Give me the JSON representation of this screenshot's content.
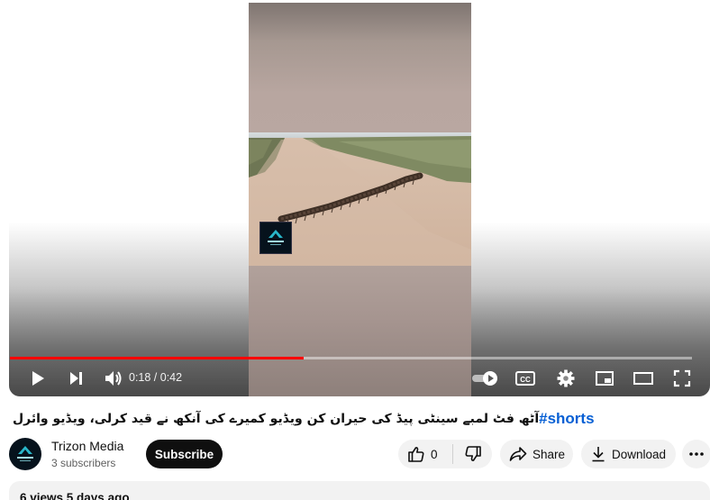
{
  "player": {
    "time_current": "0:18",
    "time_total": "0:42",
    "time_display": "0:18 / 0:42",
    "progress_fraction": 0.43,
    "controls": [
      "play-icon",
      "next-icon",
      "volume-icon",
      "autoplay-toggle",
      "captions-icon",
      "settings-icon",
      "miniplayer-icon",
      "theater-icon",
      "fullscreen-icon"
    ],
    "captions_label": "CC",
    "accent_color": "#ff0000"
  },
  "video": {
    "hashtag": "#shorts",
    "title_text": "آٹھ فٹ لمبے سینٹی پیڈ کی حیران کن ویڈیو کمیرے کی آنکھ نے قید کرلی، ویڈیو وائرل"
  },
  "channel": {
    "name": "Trizon Media",
    "subscribers": "3 subscribers",
    "avatar_icon": "trizon-logo"
  },
  "actions": {
    "subscribe_label": "Subscribe",
    "like_count": "0",
    "share_label": "Share",
    "download_label": "Download"
  },
  "description": {
    "meta": "6 views  5 days ago"
  }
}
